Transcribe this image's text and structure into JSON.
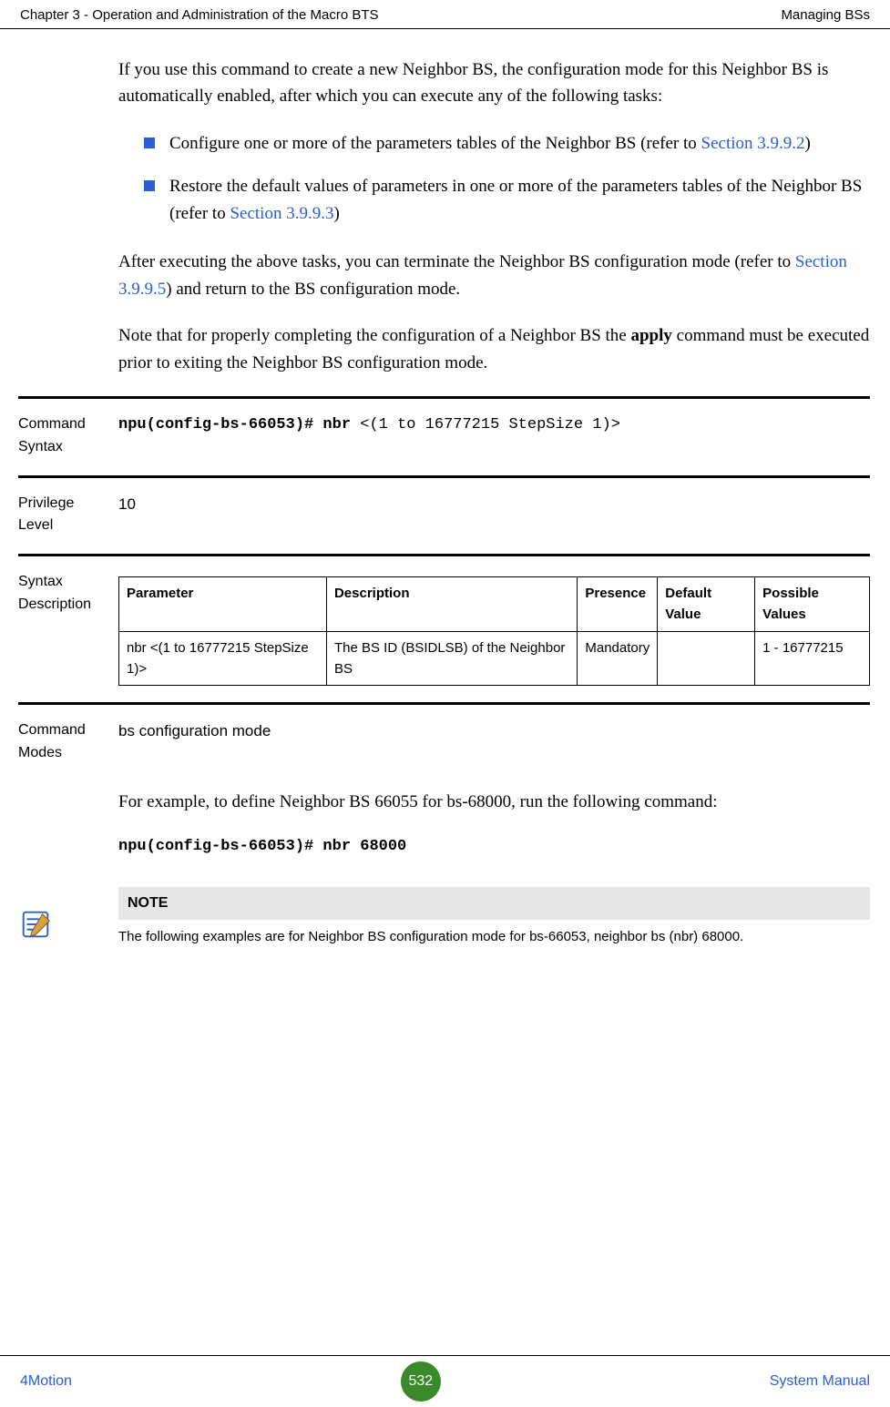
{
  "header": {
    "left": "Chapter 3 - Operation and Administration of the Macro BTS",
    "right": "Managing BSs"
  },
  "body": {
    "intro": "If you use this command to create a new Neighbor BS, the configuration mode for this Neighbor BS is automatically enabled, after which you can execute any of the following tasks:",
    "bullet1_a": "Configure one or more of the parameters tables of the Neighbor BS (refer to ",
    "bullet1_link": "Section 3.9.9.2",
    "bullet1_b": ")",
    "bullet2_a": "Restore the default values of parameters in one or more of the parameters tables of the Neighbor BS (refer to ",
    "bullet2_link": "Section 3.9.9.3",
    "bullet2_b": ")",
    "after_a": "After executing the above tasks, you can terminate the Neighbor BS configuration mode (refer to ",
    "after_link": "Section 3.9.9.5",
    "after_b": ") and return to the BS configuration mode.",
    "note_para_a": "Note that for properly completing the configuration of a Neighbor BS the ",
    "note_para_bold": "apply",
    "note_para_b": " command must be executed prior to exiting the Neighbor BS configuration mode."
  },
  "sections": {
    "command_syntax_label": "Command Syntax",
    "command_syntax_bold": "npu(config-bs-66053)# nbr ",
    "command_syntax_rest": "<(1 to 16777215 StepSize 1)>",
    "privilege_label": "Privilege Level",
    "privilege_value": "10",
    "syntax_desc_label": "Syntax Description",
    "table": {
      "headers": {
        "parameter": "Parameter",
        "description": "Description",
        "presence": "Presence",
        "default_value": "Default Value",
        "possible_values": "Possible Values"
      },
      "row": {
        "parameter": "nbr <(1 to 16777215 StepSize 1)>",
        "description": "The BS ID (BSIDLSB) of the Neighbor BS",
        "presence": "Mandatory",
        "default_value": "",
        "possible_values": "1 - 16777215"
      }
    },
    "command_modes_label": "Command Modes",
    "command_modes_value": "bs configuration mode"
  },
  "example": {
    "text": "For example, to define Neighbor BS 66055 for bs-68000, run the following command:",
    "cmd": "npu(config-bs-66053)# nbr 68000"
  },
  "note": {
    "title": "NOTE",
    "text": "The following examples are for Neighbor BS configuration mode for bs-66053, neighbor bs (nbr) 68000."
  },
  "footer": {
    "left": "4Motion",
    "page": "532",
    "right": "System Manual"
  },
  "chart_data": null
}
